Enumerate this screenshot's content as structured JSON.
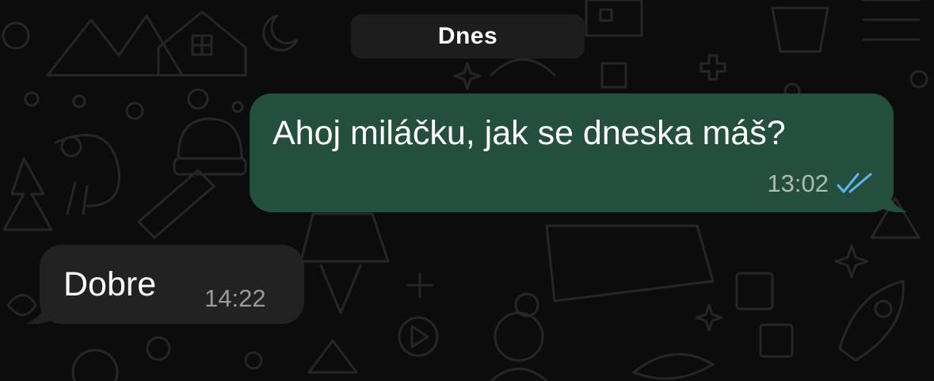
{
  "date_separator": "Dnes",
  "messages": [
    {
      "direction": "outgoing",
      "text": "Ahoj miláčku, jak se dneska máš?",
      "time": "13:02",
      "status": "read",
      "status_icon": "double-check-icon"
    },
    {
      "direction": "incoming",
      "text": "Dobre",
      "time": "14:22"
    }
  ],
  "colors": {
    "background": "#0c0c0c",
    "outgoing_bubble": "#244f3c",
    "incoming_bubble": "#222222",
    "date_pill": "#1d1d1d",
    "read_ticks": "#5fb4f4"
  }
}
